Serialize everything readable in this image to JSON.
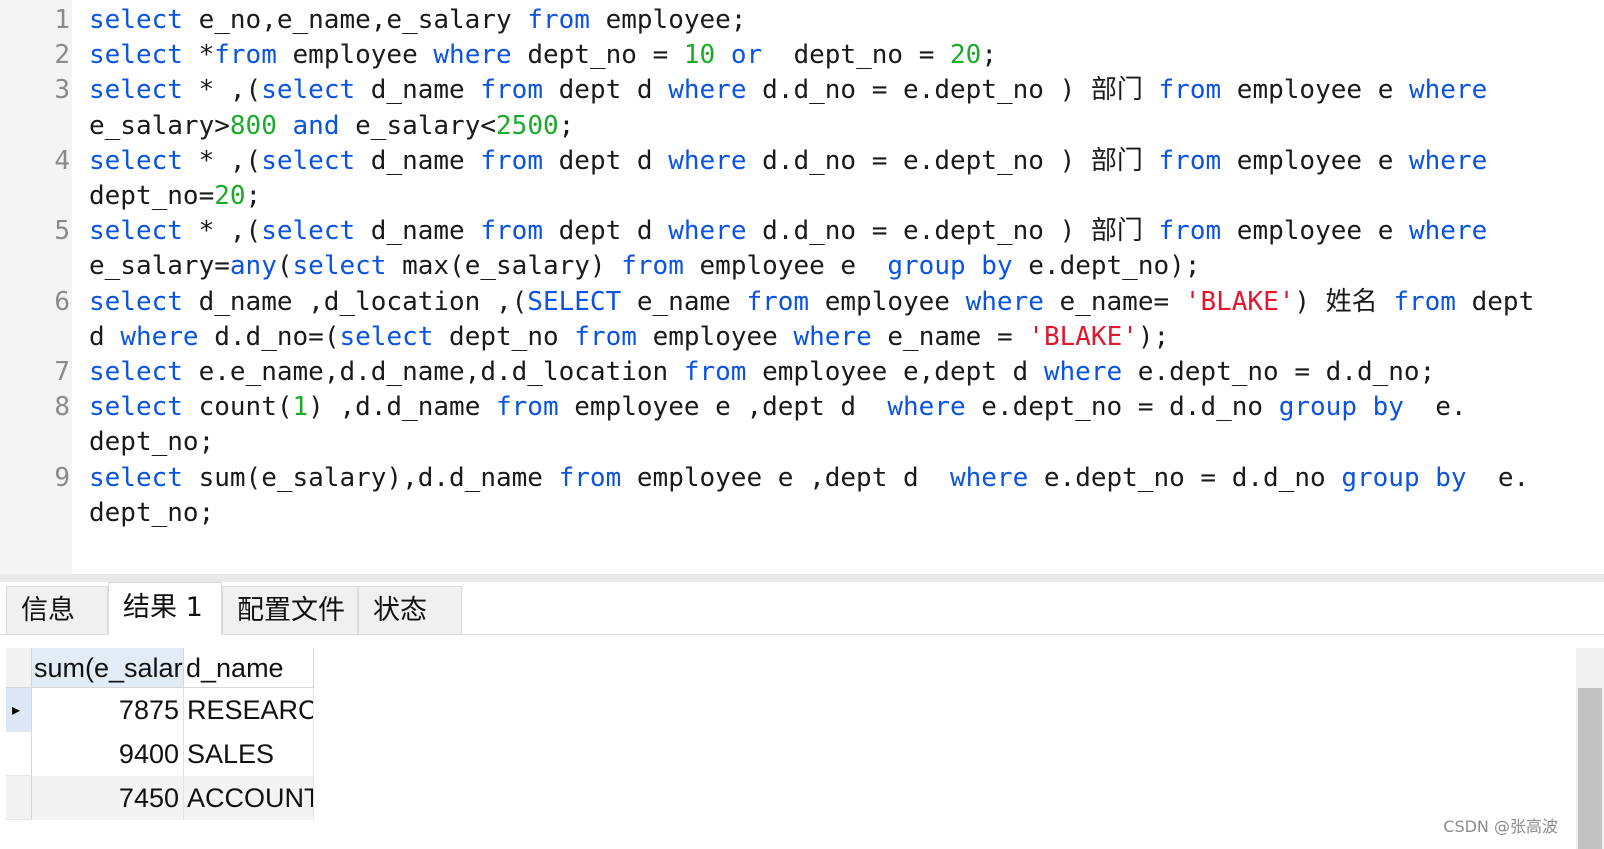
{
  "editor": {
    "lines": [
      {
        "n": "1",
        "rows": [
          [
            [
              "kw",
              "select"
            ],
            [
              "t",
              " e_no,e_name,e_salary "
            ],
            [
              "kw",
              "from"
            ],
            [
              "t",
              " employee;"
            ]
          ]
        ]
      },
      {
        "n": "2",
        "rows": [
          [
            [
              "kw",
              "select"
            ],
            [
              "t",
              " *"
            ],
            [
              "kw",
              "from"
            ],
            [
              "t",
              " employee "
            ],
            [
              "kw",
              "where"
            ],
            [
              "t",
              " dept_no = "
            ],
            [
              "num",
              "10"
            ],
            [
              "t",
              " "
            ],
            [
              "kw",
              "or"
            ],
            [
              "t",
              "  dept_no = "
            ],
            [
              "num",
              "20"
            ],
            [
              "t",
              ";"
            ]
          ]
        ]
      },
      {
        "n": "3",
        "rows": [
          [
            [
              "kw",
              "select"
            ],
            [
              "t",
              " * ,("
            ],
            [
              "kw",
              "select"
            ],
            [
              "t",
              " d_name "
            ],
            [
              "kw",
              "from"
            ],
            [
              "t",
              " dept d "
            ],
            [
              "kw",
              "where"
            ],
            [
              "t",
              " d.d_no = e.dept_no ) 部门 "
            ],
            [
              "kw",
              "from"
            ],
            [
              "t",
              " employee e "
            ],
            [
              "kw",
              "where"
            ]
          ],
          [
            [
              "t",
              "e_salary>"
            ],
            [
              "num",
              "800"
            ],
            [
              "t",
              " "
            ],
            [
              "kw",
              "and"
            ],
            [
              "t",
              " e_salary<"
            ],
            [
              "num",
              "2500"
            ],
            [
              "t",
              ";"
            ]
          ]
        ]
      },
      {
        "n": "4",
        "rows": [
          [
            [
              "kw",
              "select"
            ],
            [
              "t",
              " * ,("
            ],
            [
              "kw",
              "select"
            ],
            [
              "t",
              " d_name "
            ],
            [
              "kw",
              "from"
            ],
            [
              "t",
              " dept d "
            ],
            [
              "kw",
              "where"
            ],
            [
              "t",
              " d.d_no = e.dept_no ) 部门 "
            ],
            [
              "kw",
              "from"
            ],
            [
              "t",
              " employee e "
            ],
            [
              "kw",
              "where"
            ]
          ],
          [
            [
              "t",
              "dept_no="
            ],
            [
              "num",
              "20"
            ],
            [
              "t",
              ";"
            ]
          ]
        ]
      },
      {
        "n": "5",
        "rows": [
          [
            [
              "kw",
              "select"
            ],
            [
              "t",
              " * ,("
            ],
            [
              "kw",
              "select"
            ],
            [
              "t",
              " d_name "
            ],
            [
              "kw",
              "from"
            ],
            [
              "t",
              " dept d "
            ],
            [
              "kw",
              "where"
            ],
            [
              "t",
              " d.d_no = e.dept_no ) 部门 "
            ],
            [
              "kw",
              "from"
            ],
            [
              "t",
              " employee e "
            ],
            [
              "kw",
              "where"
            ]
          ],
          [
            [
              "t",
              "e_salary="
            ],
            [
              "kw",
              "any"
            ],
            [
              "t",
              "("
            ],
            [
              "kw",
              "select"
            ],
            [
              "t",
              " max(e_salary) "
            ],
            [
              "kw",
              "from"
            ],
            [
              "t",
              " employee e  "
            ],
            [
              "kw",
              "group by"
            ],
            [
              "t",
              " e.dept_no);"
            ]
          ]
        ]
      },
      {
        "n": "6",
        "rows": [
          [
            [
              "kw",
              "select"
            ],
            [
              "t",
              " d_name ,d_location ,("
            ],
            [
              "kw",
              "SELECT"
            ],
            [
              "t",
              " e_name "
            ],
            [
              "kw",
              "from"
            ],
            [
              "t",
              " employee "
            ],
            [
              "kw",
              "where"
            ],
            [
              "t",
              " e_name= "
            ],
            [
              "str",
              "'BLAKE'"
            ],
            [
              "t",
              ") 姓名 "
            ],
            [
              "kw",
              "from"
            ],
            [
              "t",
              " dept"
            ]
          ],
          [
            [
              "t",
              "d "
            ],
            [
              "kw",
              "where"
            ],
            [
              "t",
              " d.d_no=("
            ],
            [
              "kw",
              "select"
            ],
            [
              "t",
              " dept_no "
            ],
            [
              "kw",
              "from"
            ],
            [
              "t",
              " employee "
            ],
            [
              "kw",
              "where"
            ],
            [
              "t",
              " e_name = "
            ],
            [
              "str",
              "'BLAKE'"
            ],
            [
              "t",
              ");"
            ]
          ]
        ]
      },
      {
        "n": "7",
        "rows": [
          [
            [
              "kw",
              "select"
            ],
            [
              "t",
              " e.e_name,d.d_name,d.d_location "
            ],
            [
              "kw",
              "from"
            ],
            [
              "t",
              " employee e,dept d "
            ],
            [
              "kw",
              "where"
            ],
            [
              "t",
              " e.dept_no = d.d_no;"
            ]
          ]
        ]
      },
      {
        "n": "8",
        "rows": [
          [
            [
              "kw",
              "select"
            ],
            [
              "t",
              " count("
            ],
            [
              "num",
              "1"
            ],
            [
              "t",
              ") ,d.d_name "
            ],
            [
              "kw",
              "from"
            ],
            [
              "t",
              " employee e ,dept d  "
            ],
            [
              "kw",
              "where"
            ],
            [
              "t",
              " e.dept_no = d.d_no "
            ],
            [
              "kw",
              "group by"
            ],
            [
              "t",
              "  e."
            ]
          ],
          [
            [
              "t",
              "dept_no;"
            ]
          ]
        ]
      },
      {
        "n": "9",
        "rows": [
          [
            [
              "kw",
              "select"
            ],
            [
              "t",
              " sum(e_salary),d.d_name "
            ],
            [
              "kw",
              "from"
            ],
            [
              "t",
              " employee e ,dept d  "
            ],
            [
              "kw",
              "where"
            ],
            [
              "t",
              " e.dept_no = d.d_no "
            ],
            [
              "kw",
              "group by"
            ],
            [
              "t",
              "  e."
            ]
          ],
          [
            [
              "t",
              "dept_no;"
            ]
          ]
        ]
      }
    ]
  },
  "tabs": [
    {
      "label": "信息",
      "active": false
    },
    {
      "label": "结果 1",
      "active": true
    },
    {
      "label": "配置文件",
      "active": false
    },
    {
      "label": "状态",
      "active": false
    }
  ],
  "result": {
    "columns": [
      "sum(e_salary)",
      "d_name"
    ],
    "rows": [
      [
        "7875",
        "RESEARCH"
      ],
      [
        "9400",
        "SALES"
      ],
      [
        "7450",
        "ACCOUNTING"
      ]
    ],
    "current_row_marker": "▸"
  },
  "colors": {
    "keyword": "#0b53e2",
    "number": "#1aab2a",
    "string": "#e2162c",
    "text": "#1a1a1a",
    "line_number": "#8a8a8a"
  },
  "watermark": "CSDN @张高波"
}
